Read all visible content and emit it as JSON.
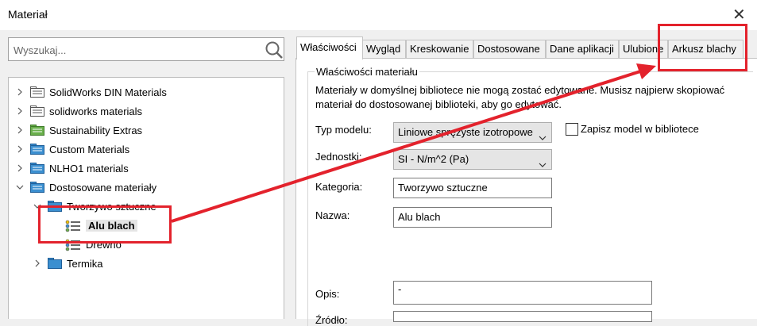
{
  "window": {
    "title": "Materiał",
    "close_icon": "close-icon"
  },
  "search": {
    "placeholder": "Wyszukaj...",
    "value": ""
  },
  "tree": {
    "items": [
      {
        "label": "SolidWorks DIN Materials",
        "expanded": false
      },
      {
        "label": "solidworks materials",
        "expanded": false
      },
      {
        "label": "Sustainability Extras",
        "expanded": false
      },
      {
        "label": "Custom Materials",
        "expanded": false
      },
      {
        "label": "NLHO1 materials",
        "expanded": false
      },
      {
        "label": "Dostosowane materiały",
        "expanded": true
      },
      {
        "label": "Tworzywo sztuczne",
        "expanded": true
      },
      {
        "label": "Alu blach",
        "selected": true
      },
      {
        "label": "Drewno"
      },
      {
        "label": "Termika",
        "expanded": false
      }
    ]
  },
  "tabs": [
    {
      "label": "Właściwości",
      "active": true
    },
    {
      "label": "Wygląd"
    },
    {
      "label": "Kreskowanie"
    },
    {
      "label": "Dostosowane"
    },
    {
      "label": "Dane aplikacji"
    },
    {
      "label": "Ulubione"
    },
    {
      "label": "Arkusz blachy"
    }
  ],
  "properties": {
    "group_label": "Właściwości materiału",
    "info_text": "Materiały w domyślnej bibliotece nie mogą zostać edytowane. Musisz najpierw skopiować materiał do dostosowanej biblioteki, aby go edytować.",
    "model_type": {
      "label": "Typ modelu:",
      "value": "Liniowe sprężyste izotropowe"
    },
    "save_in_library": {
      "label": "Zapisz model w bibliotece",
      "checked": false
    },
    "units": {
      "label": "Jednostki:",
      "value": "SI - N/m^2 (Pa)"
    },
    "category": {
      "label": "Kategoria:",
      "value": "Tworzywo sztuczne"
    },
    "name": {
      "label": "Nazwa:",
      "value": "Alu blach"
    },
    "description": {
      "label": "Opis:",
      "value": "-"
    },
    "source": {
      "label": "Źródło:"
    }
  },
  "colors": {
    "annotation": "#e3222c",
    "folder_blue": "#3b8fd0",
    "folder_green": "#6ab04c"
  }
}
